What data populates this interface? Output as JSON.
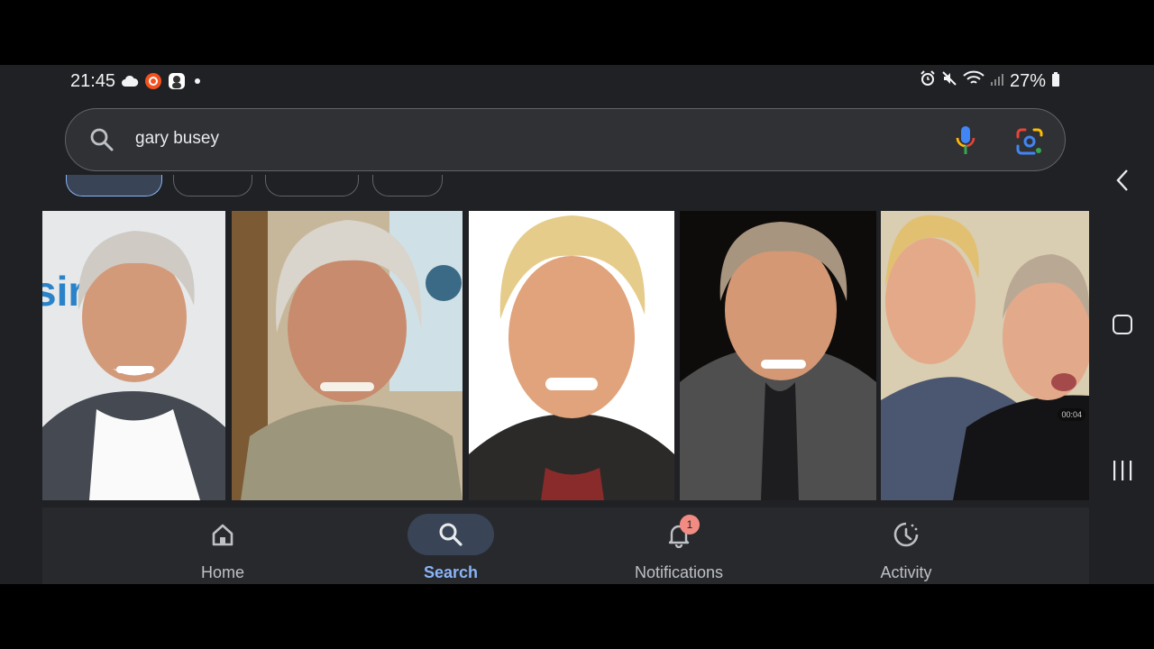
{
  "status_bar": {
    "time": "21:45",
    "battery": "27%",
    "left_icons": [
      "cloud-icon",
      "screen-recorder-icon",
      "app-avatar-icon",
      "dot-icon"
    ],
    "right_icons": [
      "alarm-icon",
      "mute-icon",
      "wifi-icon",
      "signal-icon",
      "battery-icon"
    ]
  },
  "search": {
    "query": "gary busey",
    "icons": [
      "search-icon",
      "mic-icon",
      "google-lens-icon"
    ]
  },
  "image_results": {
    "count": 5,
    "video_timestamp": "00:04"
  },
  "bottom_nav": {
    "tabs": [
      {
        "label": "Home",
        "icon": "home-icon",
        "active": false
      },
      {
        "label": "Search",
        "icon": "search-icon",
        "active": true
      },
      {
        "label": "Notifications",
        "icon": "bell-icon",
        "active": false,
        "badge": "1"
      },
      {
        "label": "Activity",
        "icon": "activity-icon",
        "active": false
      }
    ]
  },
  "system_nav": [
    "back-icon",
    "home-icon",
    "recents-icon"
  ],
  "colors": {
    "background": "#202124",
    "search_bar": "#303134",
    "accent": "#8ab4f8",
    "active_pill": "#394457",
    "badge": "#f28b82"
  }
}
